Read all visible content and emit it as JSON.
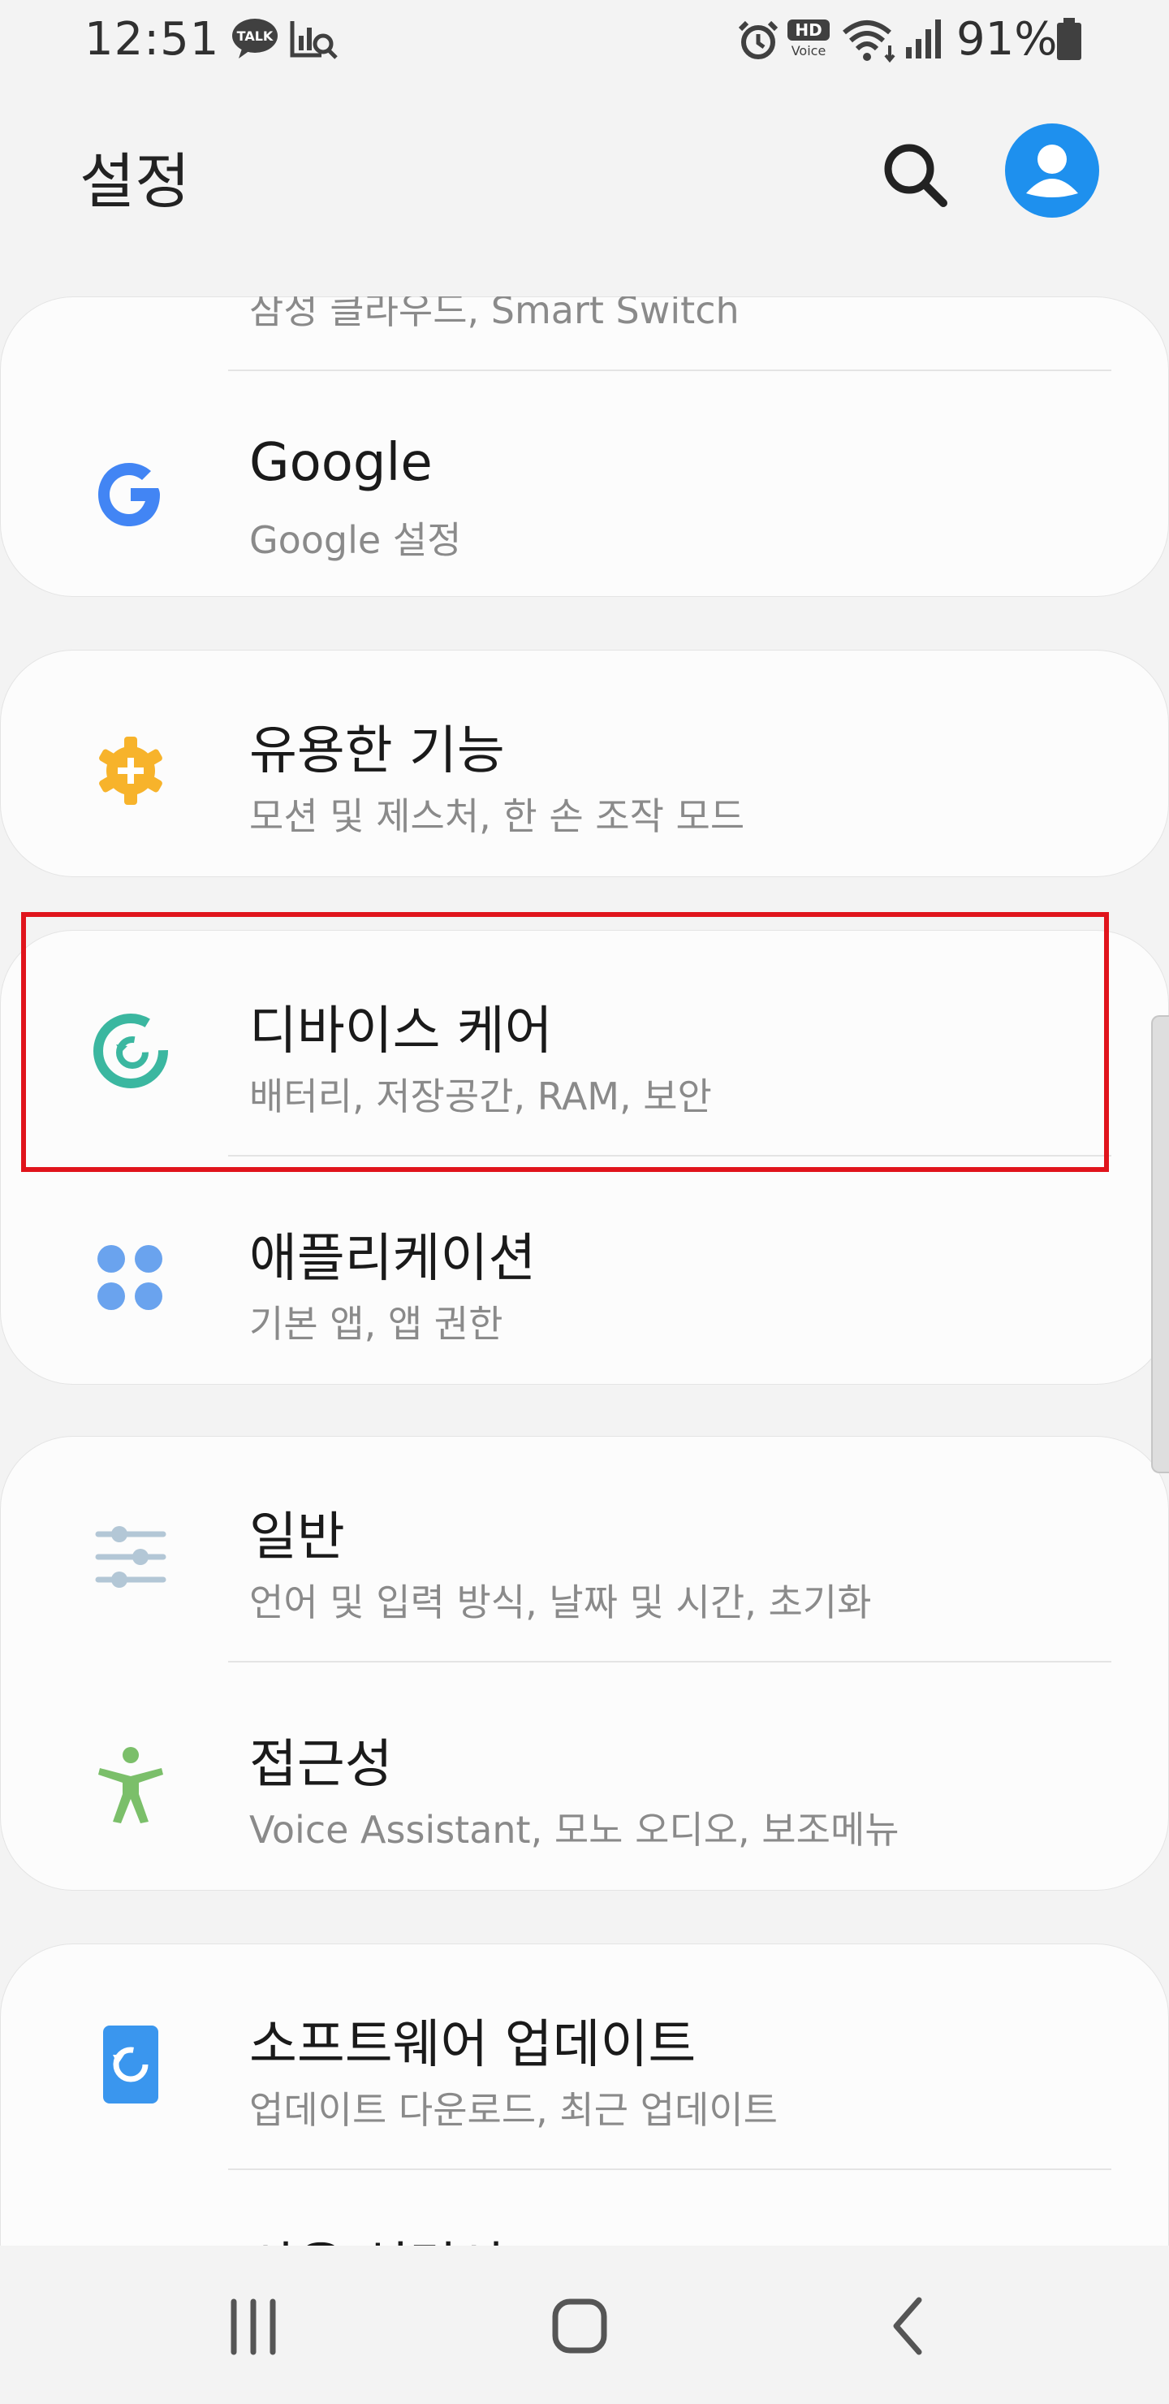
{
  "status_bar": {
    "time": "12:51",
    "battery": "91%",
    "icons": [
      "kakaotalk-icon",
      "search-analytics-icon",
      "alarm-icon",
      "hd-voice-icon",
      "wifi-icon",
      "signal-icon",
      "battery-icon"
    ],
    "hd_voice": {
      "hd": "HD",
      "voice": "Voice"
    }
  },
  "header": {
    "title": "설정"
  },
  "partial_top_item": {
    "subtitle": "삼성 클라우드, Smart Switch"
  },
  "items": [
    {
      "title": "Google",
      "subtitle": "Google 설정",
      "icon": "google-icon"
    },
    {
      "title": "유용한 기능",
      "subtitle": "모션 및 제스처, 한 손 조작 모드",
      "icon": "advanced-features-icon"
    },
    {
      "title": "디바이스 케어",
      "subtitle": "배터리, 저장공간, RAM, 보안",
      "icon": "device-care-icon"
    },
    {
      "title": "애플리케이션",
      "subtitle": "기본 앱, 앱 권한",
      "icon": "apps-icon"
    },
    {
      "title": "일반",
      "subtitle": "언어 및 입력 방식, 날짜 및 시간, 초기화",
      "icon": "general-management-icon"
    },
    {
      "title": "접근성",
      "subtitle": "Voice Assistant, 모노 오디오, 보조메뉴",
      "icon": "accessibility-icon"
    },
    {
      "title": "소프트웨어 업데이트",
      "subtitle": "업데이트 다운로드, 최근 업데이트",
      "icon": "software-update-icon"
    }
  ],
  "partial_bottom_item": {
    "title": "사용 설명서"
  },
  "colors": {
    "highlight": "#e0141c",
    "accent_blue": "#1e90ee",
    "device_care": "#3bb7a0",
    "advanced": "#f7b32b"
  }
}
